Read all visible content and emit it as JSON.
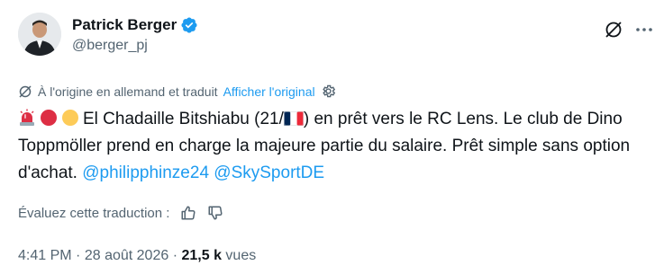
{
  "tweet": {
    "author": {
      "display_name": "Patrick Berger",
      "handle": "@berger_pj",
      "verified": true,
      "verified_color": "#1d9bf0"
    },
    "translation": {
      "note": "À l'origine en allemand et traduit",
      "show_original_label": "Afficher l'original"
    },
    "text": {
      "emojis": [
        "rotating-light-icon",
        "red-circle-icon",
        "yellow-circle-icon"
      ],
      "line1_prefix": "El Chadaille Bitshiabu (21/",
      "flag_icon": "france-flag-icon",
      "line1_suffix": ") en prêt vers le RC Lens. Le club de Dino Toppmöller prend en charge la majeure partie du salaire. Prêt simple sans option d'achat. ",
      "mentions": [
        "@philipphinze24",
        "@SkySportDE"
      ]
    },
    "rate_translation_label": "Évaluez cette traduction :",
    "meta": {
      "time": "4:41 PM",
      "date": "28 août 2026",
      "views_count": "21,5 k",
      "views_label": "vues"
    },
    "colors": {
      "text": "#0f1419",
      "secondary": "#536471",
      "link": "#1d9bf0"
    }
  }
}
